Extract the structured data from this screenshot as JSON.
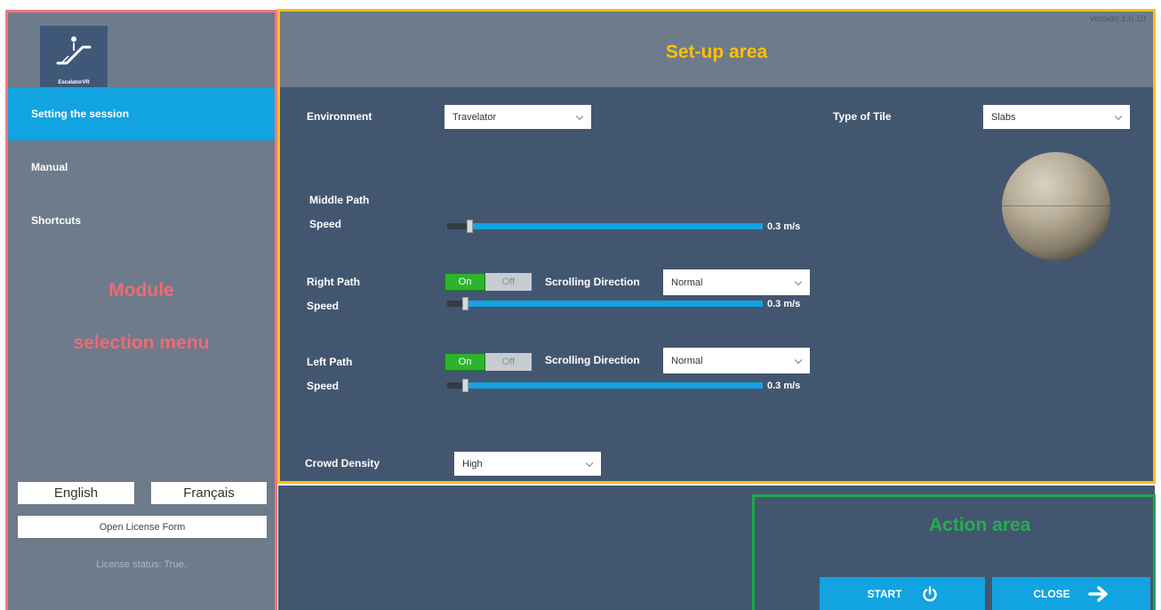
{
  "sidebar": {
    "logo_text": "EscalatorVR",
    "items": [
      {
        "label": "Setting the session",
        "active": true
      },
      {
        "label": "Manual",
        "active": false
      },
      {
        "label": "Shortcuts",
        "active": false
      }
    ],
    "overlay_line1": "Module",
    "overlay_line2": "selection menu",
    "lang_english": "English",
    "lang_french": "Français",
    "license_button": "Open License Form",
    "license_status": "License status: True."
  },
  "setup": {
    "version": "version 1.0.10",
    "title": "Set-up area",
    "environment_label": "Environment",
    "environment_value": "Travelator",
    "tile_label": "Type of Tile",
    "tile_value": "Slabs",
    "middle_path_label": "Middle Path",
    "middle_speed_label": "Speed",
    "middle_speed_value": "0.3 m/s",
    "right_path_label": "Right Path",
    "right_toggle_on": "On",
    "right_toggle_off": "Off",
    "right_scroll_label": "Scrolling Direction",
    "right_scroll_value": "Normal",
    "right_speed_label": "Speed",
    "right_speed_value": "0.3 m/s",
    "left_path_label": "Left Path",
    "left_toggle_on": "On",
    "left_toggle_off": "Off",
    "left_scroll_label": "Scrolling Direction",
    "left_scroll_value": "Normal",
    "left_speed_label": "Speed",
    "left_speed_value": "0.3 m/s",
    "crowd_label": "Crowd Density",
    "crowd_value": "High"
  },
  "action": {
    "title": "Action area",
    "start_label": "START",
    "close_label": "CLOSE"
  },
  "colors": {
    "accent": "#12a3e1",
    "sidebar_bg": "#6d7b8b",
    "panel_bg": "#435670",
    "module_frame": "#f4767e",
    "setup_frame": "#ffbe17",
    "action_frame": "#1fa84a",
    "toggle_on": "#2db42d"
  }
}
